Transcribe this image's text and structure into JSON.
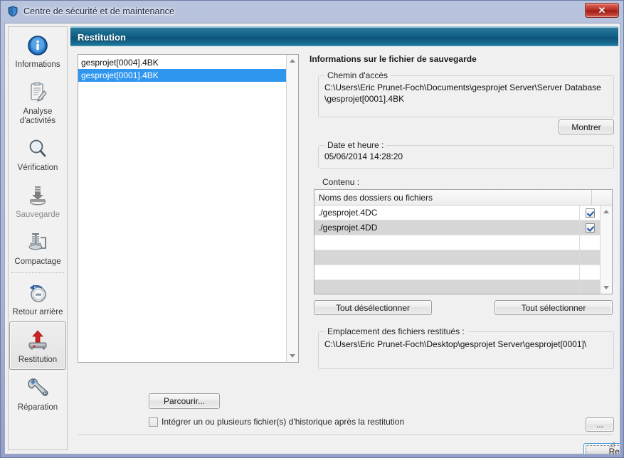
{
  "window": {
    "title": "Centre de sécurité et de maintenance",
    "title_icon": "shield-icon",
    "close_label": "✕"
  },
  "banner": {
    "title": "Restitution"
  },
  "sidebar": {
    "items": [
      {
        "label": "Informations",
        "icon": "info-circle-icon",
        "selected": false,
        "dim": false
      },
      {
        "label": "Analyse\nd'activités",
        "icon": "clipboard-pencil-icon",
        "selected": false,
        "dim": false
      },
      {
        "label": "Vérification",
        "icon": "magnifier-icon",
        "selected": false,
        "dim": false
      },
      {
        "label": "Sauvegarde",
        "icon": "backup-arrow-icon",
        "selected": false,
        "dim": true
      },
      {
        "label": "Compactage",
        "icon": "compress-press-icon",
        "selected": false,
        "dim": false
      },
      {
        "label": "Retour arrière",
        "icon": "clock-rollback-icon",
        "selected": false,
        "dim": false
      },
      {
        "label": "Restitution",
        "icon": "restore-arrow-icon",
        "selected": true,
        "dim": false
      },
      {
        "label": "Réparation",
        "icon": "wrench-icon",
        "selected": false,
        "dim": false
      }
    ]
  },
  "file_list": {
    "items": [
      {
        "name": "gesprojet[0004].4BK",
        "selected": false
      },
      {
        "name": "gesprojet[0001].4BK",
        "selected": true
      }
    ]
  },
  "browse_button": {
    "label": "Parcourir..."
  },
  "history_checkbox": {
    "label": "Intégrer un ou plusieurs fichier(s) d'historique après la restitution",
    "checked": false
  },
  "info_panel": {
    "heading": "Informations sur le fichier de sauvegarde",
    "path_group": {
      "legend": "Chemin d'accès",
      "value": "C:\\Users\\Eric Prunet-Foch\\Documents\\gesprojet Server\\Server Database\\gesprojet[0001].4BK"
    },
    "show_button": {
      "label": "Montrer"
    },
    "date_group": {
      "legend": "Date et heure :",
      "value": "05/06/2014 14:28:20"
    },
    "content": {
      "label": "Contenu :",
      "columns": [
        "Noms des dossiers ou fichiers",
        ""
      ],
      "rows": [
        {
          "name": "./gesprojet.4DC",
          "checked": true,
          "alt": false
        },
        {
          "name": "./gesprojet.4DD",
          "checked": true,
          "alt": true
        },
        {
          "name": "",
          "checked": false,
          "alt": false
        },
        {
          "name": "",
          "checked": false,
          "alt": true
        },
        {
          "name": "",
          "checked": false,
          "alt": false
        },
        {
          "name": "",
          "checked": false,
          "alt": true
        }
      ]
    },
    "deselect_all_button": {
      "label": "Tout désélectionner"
    },
    "select_all_button": {
      "label": "Tout sélectionner"
    },
    "destination_group": {
      "legend": "Emplacement des fichiers restitués :",
      "value": "C:\\Users\\Eric Prunet-Foch\\Desktop\\gesprojet Server\\gesprojet[0001]\\"
    },
    "ellipsis_button": {
      "label": "..."
    }
  },
  "footer": {
    "restitution_button": {
      "label": "Restitution"
    }
  },
  "colors": {
    "banner_blue": "#0f5d82",
    "selection_blue": "#2f96f0",
    "close_red": "#b42c20",
    "focus_outline": "#3c9ad6",
    "panel_bg": "#f0f0f0"
  }
}
